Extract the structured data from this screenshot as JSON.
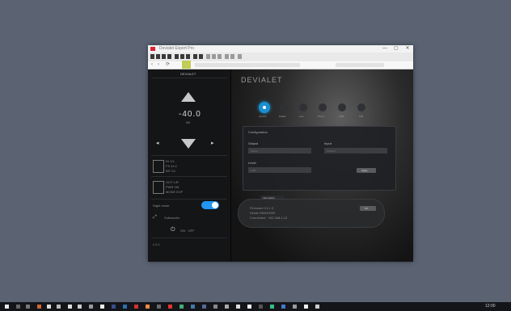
{
  "window": {
    "title": "Devialet Expert Pro",
    "controls": [
      "—",
      "▢",
      "✕"
    ]
  },
  "toolbar": {
    "icons": [
      "back-icon",
      "forward-icon",
      "home-icon",
      "save-icon",
      "print-icon",
      "copy-icon",
      "paste-icon",
      "cut-icon",
      "undo-icon",
      "redo-icon",
      "find-icon",
      "zoom-icon",
      "settings-icon",
      "help-icon",
      "info-icon"
    ]
  },
  "nav": {
    "back": "‹",
    "forward": "›",
    "refresh": "⟳"
  },
  "left_panel": {
    "header": "DEVIALET",
    "volume_value": "-40.0",
    "volume_unit": "dB",
    "source_left": "◂",
    "source_right": "▸",
    "info1": [
      "IN  1/1",
      "FS  44.1",
      "BIT 24"
    ],
    "info2": [
      "OUT  L/R",
      "PWR  ON",
      "MODE  EXP"
    ],
    "toggle_label": "Night mode",
    "toggle_on": true,
    "sub_label": "Subwoofer",
    "power_label": "ON · OFF",
    "footer": "v 2.1"
  },
  "right_panel": {
    "brand": "DEVIALET",
    "presets": [
      "Optical",
      "Digital",
      "Line",
      "Phono",
      "USB",
      "AIR"
    ],
    "dialog1": {
      "title": "Configuration",
      "field1_label": "Output",
      "field1_value": "Stereo",
      "field2_label": "Input",
      "field2_value": "Optical 1",
      "field3_label": "Level",
      "field3_value": "0 dB",
      "button": "Apply"
    },
    "dialog2": {
      "title": "Information",
      "lines": [
        "Firmware 13.1.3",
        "Serial 000000000",
        "Connected · 192.168.1.10"
      ],
      "button": "OK"
    }
  },
  "colors": {
    "desktop": "#5b6373",
    "accent": "#2196f3",
    "highlight": "#b9c63a"
  },
  "taskbar": {
    "clock": "12:00"
  }
}
